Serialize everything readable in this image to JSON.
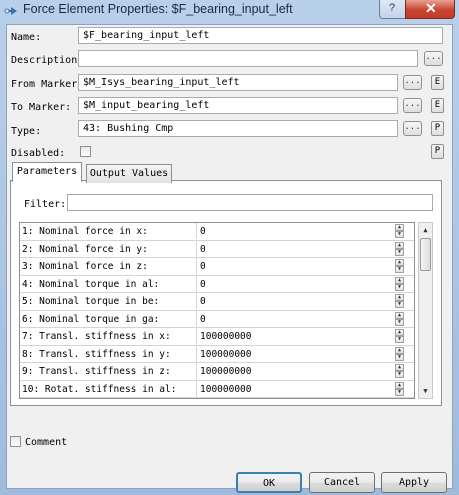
{
  "window": {
    "title": "Force Element Properties: $F_bearing_input_left",
    "help_label": "?",
    "close_label": "✕"
  },
  "form": {
    "name_label": "Name:",
    "name_value": "$F_bearing_input_left",
    "description_label": "Description:",
    "description_value": "",
    "description_button": "...",
    "from_marker_label": "From Marker:",
    "from_marker_value": "$M_Isys_bearing_input_left",
    "to_marker_label": "To Marker:",
    "to_marker_value": "$M_input_bearing_left",
    "type_label": "Type:",
    "type_value": "43: Bushing Cmp",
    "disabled_label": "Disabled:",
    "disabled_checked": false,
    "browse_button": "...",
    "e_button": "E",
    "p_button": "P"
  },
  "tabs": [
    {
      "label": "Parameters",
      "active": true
    },
    {
      "label": "Output Values",
      "active": false
    }
  ],
  "filter": {
    "label": "Filter:",
    "value": ""
  },
  "parameters": [
    {
      "name": "1: Nominal force in x:",
      "value": "0"
    },
    {
      "name": "2: Nominal force in y:",
      "value": "0"
    },
    {
      "name": "3: Nominal force in z:",
      "value": "0"
    },
    {
      "name": "4: Nominal torque in al:",
      "value": "0"
    },
    {
      "name": "5: Nominal torque in be:",
      "value": "0"
    },
    {
      "name": "6: Nominal torque in ga:",
      "value": "0"
    },
    {
      "name": "7: Transl. stiffness in x:",
      "value": "100000000"
    },
    {
      "name": "8: Transl. stiffness in y:",
      "value": "100000000"
    },
    {
      "name": "9: Transl. stiffness in z:",
      "value": "100000000"
    },
    {
      "name": "10: Rotat. stiffness in al:",
      "value": "100000000"
    }
  ],
  "comment": {
    "label": "Comment",
    "checked": false
  },
  "buttons": {
    "ok": "OK",
    "cancel": "Cancel",
    "apply": "Apply"
  },
  "colors": {
    "titlebar": "#b8d0ea",
    "dialog_bg": "#f0f0f0",
    "close_btn": "#c9452f"
  }
}
